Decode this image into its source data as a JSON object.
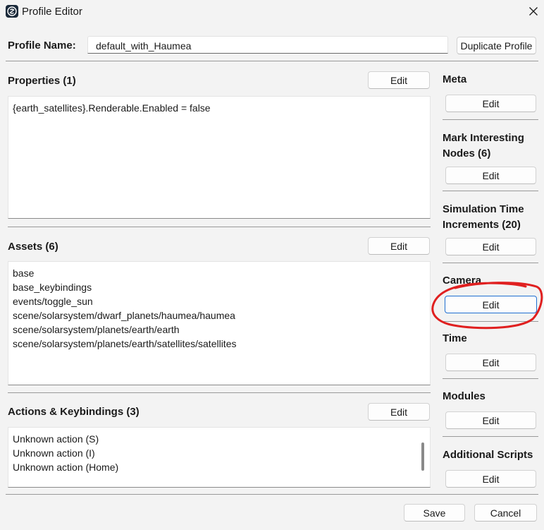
{
  "window": {
    "title": "Profile Editor",
    "icon": "openspace-app-icon",
    "close_icon": "close-icon"
  },
  "profile": {
    "name_label": "Profile Name:",
    "name_value": "default_with_Haumea",
    "duplicate_label": "Duplicate Profile"
  },
  "properties": {
    "title": "Properties (1)",
    "edit_label": "Edit",
    "lines": [
      "{earth_satellites}.Renderable.Enabled = false"
    ]
  },
  "assets": {
    "title": "Assets (6)",
    "edit_label": "Edit",
    "lines": [
      "base",
      "base_keybindings",
      "events/toggle_sun",
      "scene/solarsystem/dwarf_planets/haumea/haumea",
      "scene/solarsystem/planets/earth/earth",
      "scene/solarsystem/planets/earth/satellites/satellites"
    ]
  },
  "actions": {
    "title": "Actions & Keybindings (3)",
    "edit_label": "Edit",
    "lines": [
      "Unknown action (S)",
      "Unknown action (I)",
      "Unknown action (Home)"
    ]
  },
  "side": {
    "meta": {
      "title": "Meta",
      "edit_label": "Edit"
    },
    "mark_nodes": {
      "title_line1": "Mark Interesting",
      "title_line2": "Nodes (6)",
      "edit_label": "Edit"
    },
    "sim_time": {
      "title_line1": "Simulation Time",
      "title_line2": "Increments (20)",
      "edit_label": "Edit"
    },
    "camera": {
      "title": "Camera",
      "edit_label": "Edit"
    },
    "time": {
      "title": "Time",
      "edit_label": "Edit"
    },
    "modules": {
      "title": "Modules",
      "edit_label": "Edit"
    },
    "scripts": {
      "title": "Additional Scripts",
      "edit_label": "Edit"
    }
  },
  "footer": {
    "save_label": "Save",
    "cancel_label": "Cancel"
  },
  "colors": {
    "annotation": "#e02020",
    "focus_border": "#1f6fd1"
  }
}
